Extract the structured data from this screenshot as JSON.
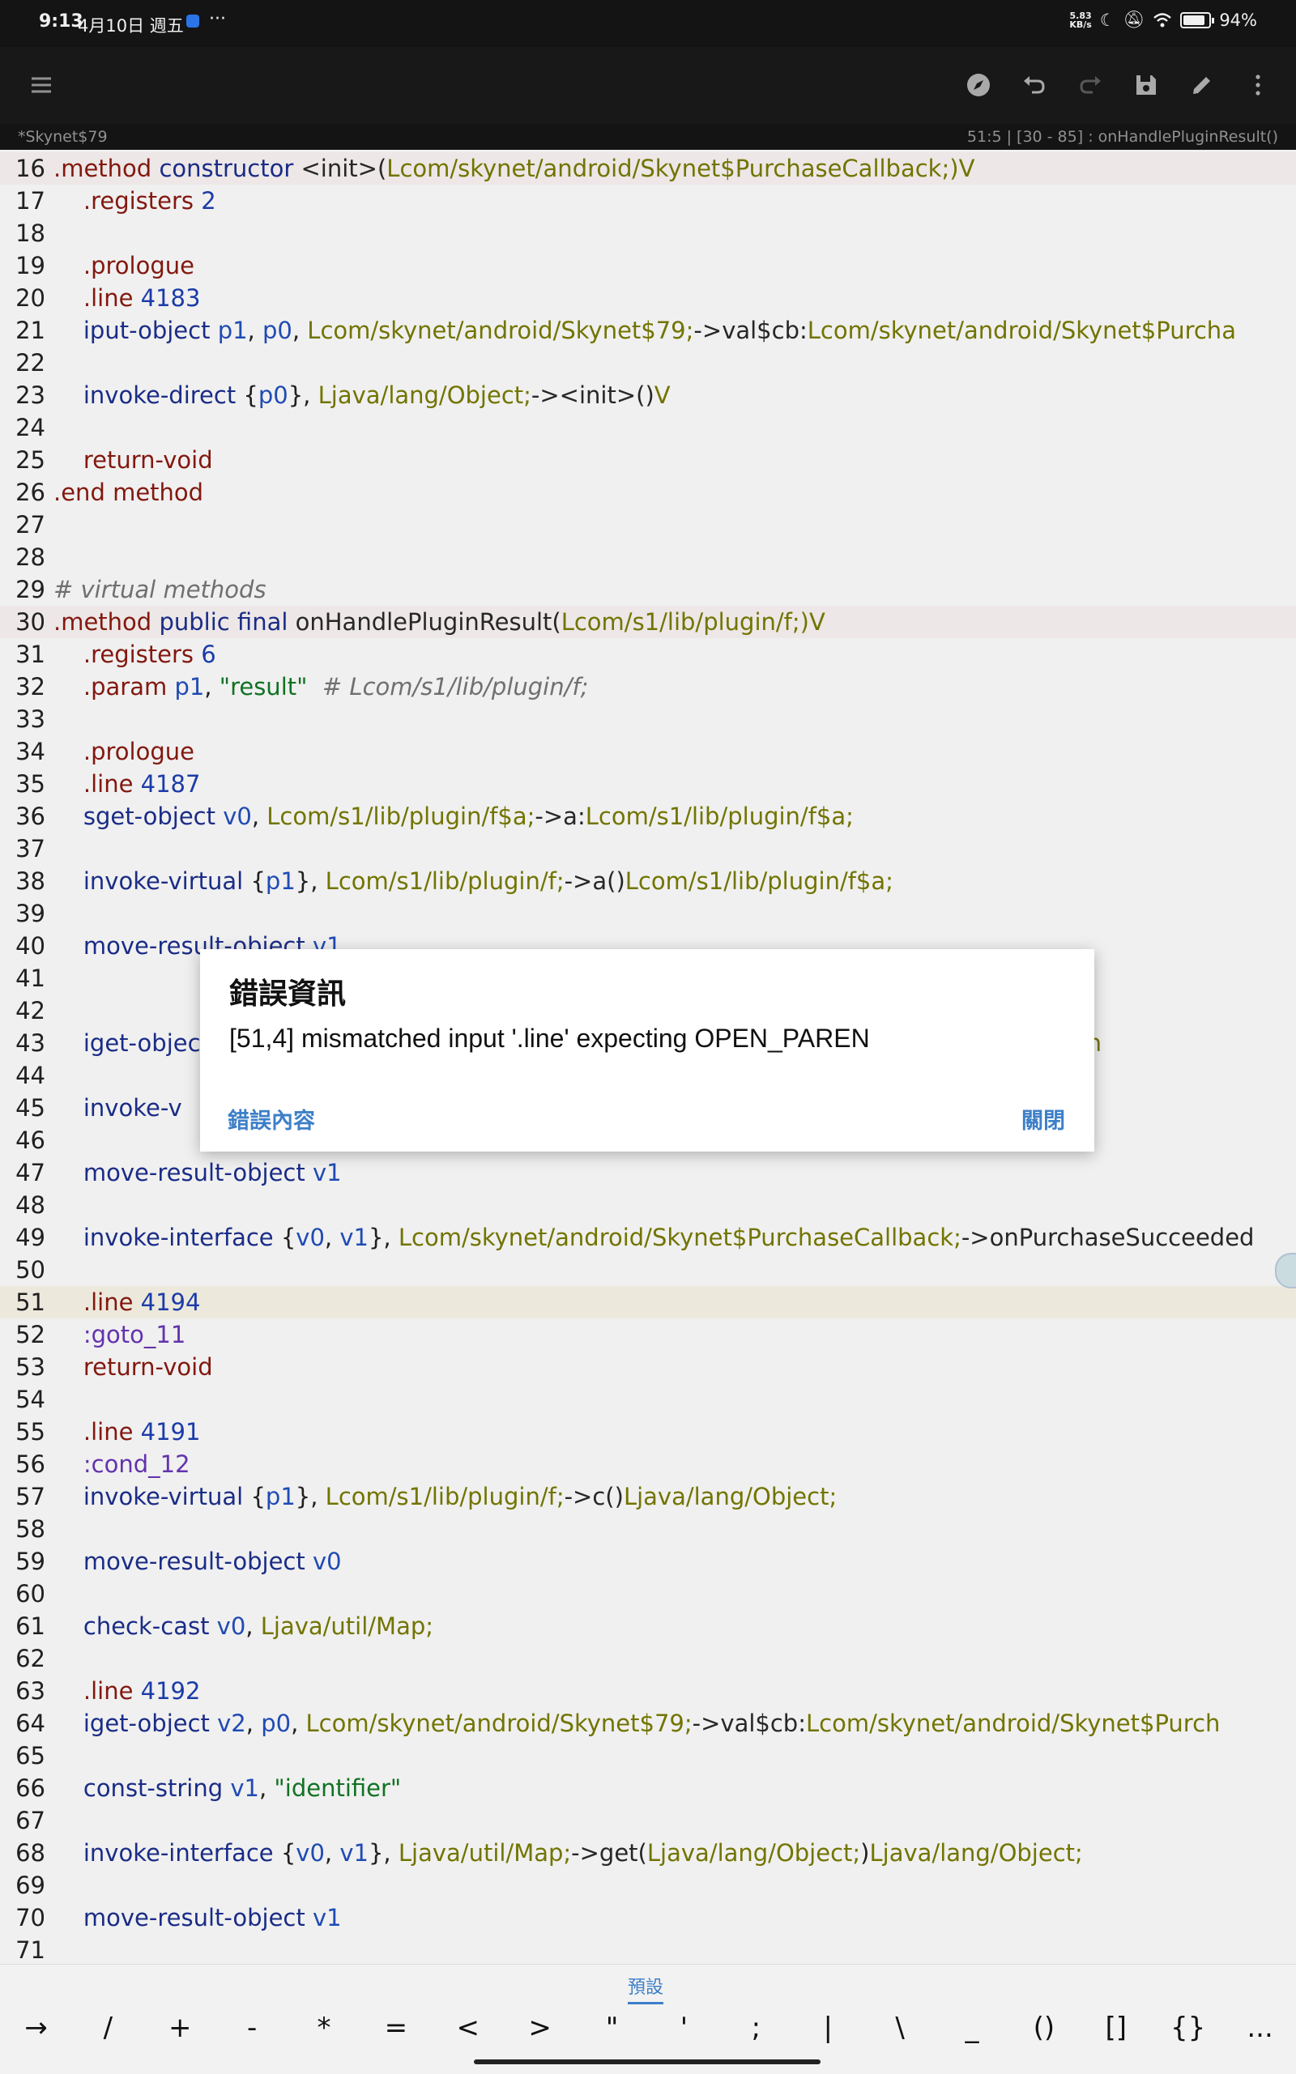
{
  "status": {
    "time": "9:13",
    "date": "4月10日 週五",
    "dots": "···",
    "netspeed_value": "5.83",
    "netspeed_unit": "KB/s",
    "battery": "94%"
  },
  "toolbar": {
    "icons": [
      "menu-icon",
      "compass-icon",
      "undo-icon",
      "redo-icon",
      "save-icon",
      "edit-icon",
      "more-vert-icon"
    ]
  },
  "infobar": {
    "file_title": "*Skynet$79",
    "position": "51:5  |  [30 - 85] : onHandlePluginResult()"
  },
  "code_lines": [
    {
      "n": "16",
      "t": [
        [
          ".method",
          "kw-dir"
        ],
        " ",
        [
          "constructor",
          "kw-op"
        ],
        " ",
        [
          "<init>(",
          "mem"
        ],
        [
          "Lcom/skynet/android/Skynet$PurchaseCallback;",
          "type"
        ],
        [
          ")V",
          "type"
        ]
      ]
    },
    {
      "n": "17",
      "t": [
        "    ",
        [
          ".registers",
          "kw-dir"
        ],
        " ",
        [
          "2",
          "num"
        ]
      ]
    },
    {
      "n": "18",
      "t": []
    },
    {
      "n": "19",
      "t": [
        "    ",
        [
          ".prologue",
          "kw-dir"
        ]
      ]
    },
    {
      "n": "20",
      "t": [
        "    ",
        [
          ".line",
          "kw-dir"
        ],
        " ",
        [
          "4183",
          "num"
        ]
      ]
    },
    {
      "n": "21",
      "t": [
        "    ",
        [
          "iput-object",
          "kw-op"
        ],
        " ",
        [
          "p1",
          "reg"
        ],
        ", ",
        [
          "p0",
          "reg"
        ],
        ", ",
        [
          "Lcom/skynet/android/Skynet$79;",
          "type"
        ],
        [
          "->",
          "mem"
        ],
        [
          "val$cb",
          "mem"
        ],
        [
          ":",
          "punc"
        ],
        [
          "Lcom/skynet/android/Skynet$Purcha",
          "type"
        ]
      ]
    },
    {
      "n": "22",
      "t": []
    },
    {
      "n": "23",
      "t": [
        "    ",
        [
          "invoke-direct",
          "kw-op"
        ],
        " {",
        [
          "p0",
          "reg"
        ],
        "}, ",
        [
          "Ljava/lang/Object;",
          "type"
        ],
        [
          "-><init>()",
          "mem"
        ],
        [
          "V",
          "type"
        ]
      ]
    },
    {
      "n": "24",
      "t": []
    },
    {
      "n": "25",
      "t": [
        "    ",
        [
          "return-void",
          "kw-dir"
        ]
      ]
    },
    {
      "n": "26",
      "t": [
        [
          ".end",
          "kw-dir"
        ],
        " ",
        [
          "method",
          "kw-dir"
        ]
      ]
    },
    {
      "n": "27",
      "t": []
    },
    {
      "n": "28",
      "t": []
    },
    {
      "n": "29",
      "t": [
        [
          "# virtual methods",
          "cmt"
        ]
      ]
    },
    {
      "n": "30",
      "t": [
        [
          ".method",
          "kw-dir"
        ],
        " ",
        [
          "public",
          "kw-op"
        ],
        " ",
        [
          "final",
          "kw-op"
        ],
        " ",
        [
          "onHandlePluginResult(",
          "mem"
        ],
        [
          "Lcom/s1/lib/plugin/f;",
          "type"
        ],
        [
          ")V",
          "type"
        ]
      ]
    },
    {
      "n": "31",
      "t": [
        "    ",
        [
          ".registers",
          "kw-dir"
        ],
        " ",
        [
          "6",
          "num"
        ]
      ]
    },
    {
      "n": "32",
      "t": [
        "    ",
        [
          ".param",
          "kw-dir"
        ],
        " ",
        [
          "p1",
          "reg"
        ],
        ", ",
        [
          "\"result\"",
          "str"
        ],
        "  ",
        [
          "# Lcom/s1/lib/plugin/f;",
          "cmt"
        ]
      ]
    },
    {
      "n": "33",
      "t": []
    },
    {
      "n": "34",
      "t": [
        "    ",
        [
          ".prologue",
          "kw-dir"
        ]
      ]
    },
    {
      "n": "35",
      "t": [
        "    ",
        [
          ".line",
          "kw-dir"
        ],
        " ",
        [
          "4187",
          "num"
        ]
      ]
    },
    {
      "n": "36",
      "t": [
        "    ",
        [
          "sget-object",
          "kw-op"
        ],
        " ",
        [
          "v0",
          "reg"
        ],
        ", ",
        [
          "Lcom/s1/lib/plugin/f$a;",
          "type"
        ],
        [
          "->a",
          "mem"
        ],
        [
          ":",
          "punc"
        ],
        [
          "Lcom/s1/lib/plugin/f$a;",
          "type"
        ]
      ]
    },
    {
      "n": "37",
      "t": []
    },
    {
      "n": "38",
      "t": [
        "    ",
        [
          "invoke-virtual",
          "kw-op"
        ],
        " {",
        [
          "p1",
          "reg"
        ],
        "}, ",
        [
          "Lcom/s1/lib/plugin/f;",
          "type"
        ],
        [
          "->a()",
          "mem"
        ],
        [
          "Lcom/s1/lib/plugin/f$a;",
          "type"
        ]
      ]
    },
    {
      "n": "39",
      "t": []
    },
    {
      "n": "40",
      "t": [
        "    ",
        [
          "move-result-object",
          "kw-op"
        ],
        " ",
        [
          "v1",
          "reg"
        ]
      ]
    },
    {
      "n": "41",
      "t": []
    },
    {
      "n": "42",
      "t": []
    },
    {
      "n": "43",
      "t": [
        "    ",
        [
          "iget-object",
          "kw-op"
        ],
        "                                                                                              ",
        [
          "id/Skynet$Purch",
          "type"
        ]
      ]
    },
    {
      "n": "44",
      "t": []
    },
    {
      "n": "45",
      "t": [
        "    ",
        [
          "invoke-v",
          "kw-op"
        ]
      ]
    },
    {
      "n": "46",
      "t": []
    },
    {
      "n": "47",
      "t": [
        "    ",
        [
          "move-result-object",
          "kw-op"
        ],
        " ",
        [
          "v1",
          "reg"
        ]
      ]
    },
    {
      "n": "48",
      "t": []
    },
    {
      "n": "49",
      "t": [
        "    ",
        [
          "invoke-interface",
          "kw-op"
        ],
        " {",
        [
          "v0",
          "reg"
        ],
        ", ",
        [
          "v1",
          "reg"
        ],
        "}, ",
        [
          "Lcom/skynet/android/Skynet$PurchaseCallback;",
          "type"
        ],
        [
          "->onPurchaseSucceeded",
          "mem"
        ]
      ]
    },
    {
      "n": "50",
      "t": []
    },
    {
      "n": "51",
      "t": [
        "    ",
        [
          ".line",
          "kw-dir"
        ],
        " ",
        [
          "4194",
          "num"
        ]
      ]
    },
    {
      "n": "52",
      "t": [
        "    ",
        [
          ":goto_11",
          "lbl"
        ]
      ]
    },
    {
      "n": "53",
      "t": [
        "    ",
        [
          "return-void",
          "kw-dir"
        ]
      ]
    },
    {
      "n": "54",
      "t": []
    },
    {
      "n": "55",
      "t": [
        "    ",
        [
          ".line",
          "kw-dir"
        ],
        " ",
        [
          "4191",
          "num"
        ]
      ]
    },
    {
      "n": "56",
      "t": [
        "    ",
        [
          ":cond_12",
          "lbl"
        ]
      ]
    },
    {
      "n": "57",
      "t": [
        "    ",
        [
          "invoke-virtual",
          "kw-op"
        ],
        " {",
        [
          "p1",
          "reg"
        ],
        "}, ",
        [
          "Lcom/s1/lib/plugin/f;",
          "type"
        ],
        [
          "->c()",
          "mem"
        ],
        [
          "Ljava/lang/Object;",
          "type"
        ]
      ]
    },
    {
      "n": "58",
      "t": []
    },
    {
      "n": "59",
      "t": [
        "    ",
        [
          "move-result-object",
          "kw-op"
        ],
        " ",
        [
          "v0",
          "reg"
        ]
      ]
    },
    {
      "n": "60",
      "t": []
    },
    {
      "n": "61",
      "t": [
        "    ",
        [
          "check-cast",
          "kw-op"
        ],
        " ",
        [
          "v0",
          "reg"
        ],
        ", ",
        [
          "Ljava/util/Map;",
          "type"
        ]
      ]
    },
    {
      "n": "62",
      "t": []
    },
    {
      "n": "63",
      "t": [
        "    ",
        [
          ".line",
          "kw-dir"
        ],
        " ",
        [
          "4192",
          "num"
        ]
      ]
    },
    {
      "n": "64",
      "t": [
        "    ",
        [
          "iget-object",
          "kw-op"
        ],
        " ",
        [
          "v2",
          "reg"
        ],
        ", ",
        [
          "p0",
          "reg"
        ],
        ", ",
        [
          "Lcom/skynet/android/Skynet$79;",
          "type"
        ],
        [
          "->val$cb",
          "mem"
        ],
        [
          ":",
          "punc"
        ],
        [
          "Lcom/skynet/android/Skynet$Purch",
          "type"
        ]
      ]
    },
    {
      "n": "65",
      "t": []
    },
    {
      "n": "66",
      "t": [
        "    ",
        [
          "const-string",
          "kw-op"
        ],
        " ",
        [
          "v1",
          "reg"
        ],
        ", ",
        [
          "\"identifier\"",
          "str"
        ]
      ]
    },
    {
      "n": "67",
      "t": []
    },
    {
      "n": "68",
      "t": [
        "    ",
        [
          "invoke-interface",
          "kw-op"
        ],
        " {",
        [
          "v0",
          "reg"
        ],
        ", ",
        [
          "v1",
          "reg"
        ],
        "}, ",
        [
          "Ljava/util/Map;",
          "type"
        ],
        [
          "->get(",
          "mem"
        ],
        [
          "Ljava/lang/Object;",
          "type"
        ],
        [
          ")",
          "punc"
        ],
        [
          "Ljava/lang/Object;",
          "type"
        ]
      ]
    },
    {
      "n": "69",
      "t": []
    },
    {
      "n": "70",
      "t": [
        "    ",
        [
          "move-result-object",
          "kw-op"
        ],
        " ",
        [
          "v1",
          "reg"
        ]
      ]
    },
    {
      "n": "71",
      "t": []
    }
  ],
  "highlight": {
    "method_lines": [
      "16",
      "30"
    ],
    "cursor_line": "51"
  },
  "dialog": {
    "title": "錯誤資訊",
    "message": "[51,4] mismatched input '.line' expecting OPEN_PAREN",
    "detail_button": "錯誤內容",
    "close_button": "關閉"
  },
  "keybar": {
    "preset_label": "預設",
    "keys": [
      "→",
      "/",
      "+",
      "-",
      "*",
      "=",
      "<",
      ">",
      "\"",
      "'",
      ";",
      "|",
      "\\",
      "_",
      "()",
      "[]",
      "{}",
      "..."
    ]
  }
}
